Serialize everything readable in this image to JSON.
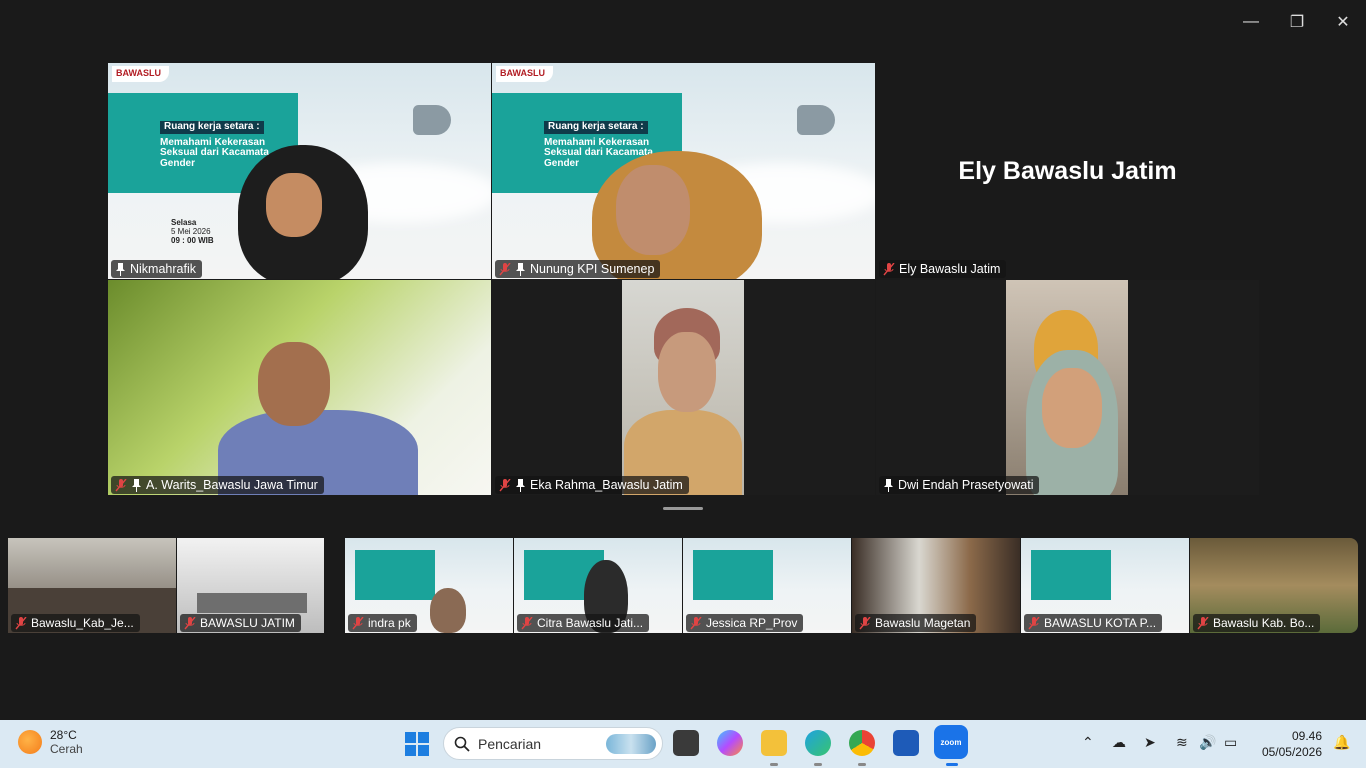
{
  "window": {
    "controls": {
      "minimize": "—",
      "restore": "❐",
      "close": "✕"
    }
  },
  "main_grid": [
    {
      "name": "Nikmahrafik",
      "mic_muted": false,
      "pinned": true,
      "active_speaker": true
    },
    {
      "name": "Nunung KPI Sumenep",
      "mic_muted": true,
      "pinned": true
    },
    {
      "name": "Ely Bawaslu Jatim",
      "mic_muted": true,
      "pinned": false,
      "display_name_large": "Ely Bawaslu Jatim"
    },
    {
      "name": "A. Warits_Bawaslu Jawa Timur",
      "mic_muted": true,
      "pinned": true
    },
    {
      "name": "Eka Rahma_Bawaslu Jatim",
      "mic_muted": true,
      "pinned": true
    },
    {
      "name": "Dwi Endah Prasetyowati",
      "mic_muted": false,
      "pinned": true
    }
  ],
  "slide": {
    "logo": "BAWASLU",
    "heading": "Ruang kerja setara :",
    "title_lines": [
      "Memahami Kekerasan",
      "Seksual dari Kacamata",
      "Gender"
    ],
    "date_label": "Selasa",
    "date_value": "5 Mei 2026",
    "time_value": "09 : 00 WIB"
  },
  "strip": [
    {
      "name": "Bawaslu_Kab_Je...",
      "mic_muted": true
    },
    {
      "name": "BAWASLU JATIM",
      "mic_muted": true
    },
    {
      "name": "indra pk",
      "mic_muted": true
    },
    {
      "name": "Citra Bawaslu Jati...",
      "mic_muted": true
    },
    {
      "name": "Jessica RP_Prov",
      "mic_muted": true
    },
    {
      "name": "Bawaslu Magetan",
      "mic_muted": true
    },
    {
      "name": "BAWASLU KOTA P...",
      "mic_muted": true
    },
    {
      "name": "Bawaslu Kab. Bo...",
      "mic_muted": true
    }
  ],
  "taskbar": {
    "weather_temp": "28°C",
    "weather_desc": "Cerah",
    "search_placeholder": "Pencarian",
    "time": "09.46",
    "date": "05/05/2026",
    "zoom_label": "zoom"
  }
}
